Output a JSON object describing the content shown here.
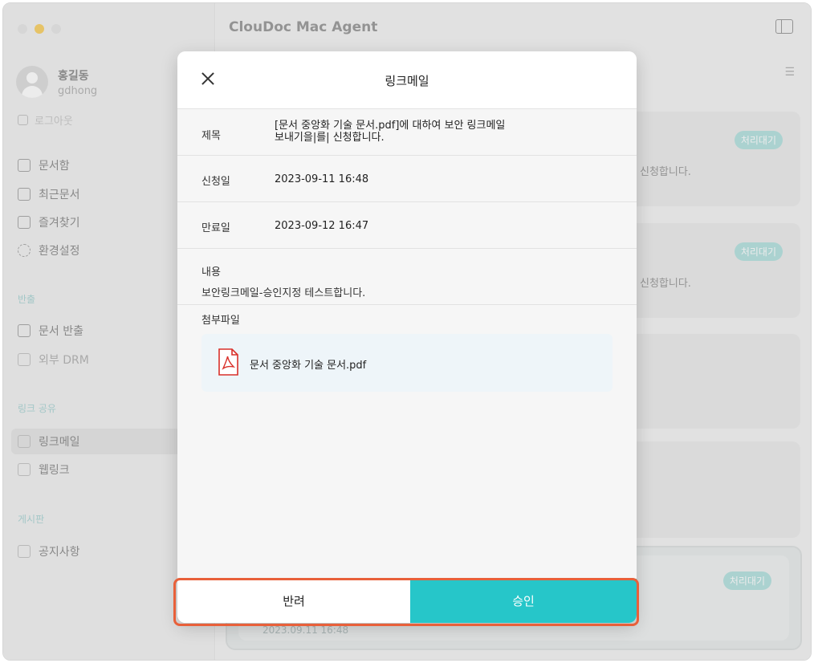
{
  "app": {
    "title": "ClouDoc Mac Agent"
  },
  "profile": {
    "name": "홍길동",
    "id": "gdhong",
    "logout": "로그아웃"
  },
  "nav": {
    "main": [
      {
        "label": "문서함"
      },
      {
        "label": "최근문서"
      },
      {
        "label": "즐겨찾기"
      },
      {
        "label": "환경설정"
      }
    ],
    "export_title": "반출",
    "export": [
      {
        "label": "문서 반출"
      },
      {
        "label": "외부 DRM"
      }
    ],
    "link_title": "링크 공유",
    "link": [
      {
        "label": "링크메일"
      },
      {
        "label": "웹링크"
      }
    ],
    "board_title": "게시판",
    "board": [
      {
        "label": "공지사항"
      }
    ]
  },
  "list": {
    "cards": [
      {
        "badge": "처리대기",
        "text": "신청합니다."
      },
      {
        "badge": "처리대기",
        "text": "신청합니다."
      },
      {
        "badge": "처리대기"
      }
    ],
    "bottom_date": "2023.09.11 16:48"
  },
  "modal": {
    "title": "링크메일",
    "subject_label": "제목",
    "subject_line1": "[문서 중앙화 기술 문서.pdf]에 대하여 보안 링크메일",
    "subject_line2": "보내기을|를| 신청합니다.",
    "request_label": "신청일",
    "request_date": "2023-09-11 16:48",
    "expire_label": "만료일",
    "expire_date": "2023-09-12 16:47",
    "content_label": "내용",
    "content_text": "보안링크메일-승인지정 테스트합니다.",
    "attach_label": "첨부파일",
    "attach_file": "문서 중앙화 기술 문서.pdf",
    "reject_label": "반려",
    "approve_label": "승인"
  },
  "colors": {
    "accent": "#26c6c9",
    "highlight": "#e8603a",
    "badge": "#9cd7d5"
  }
}
